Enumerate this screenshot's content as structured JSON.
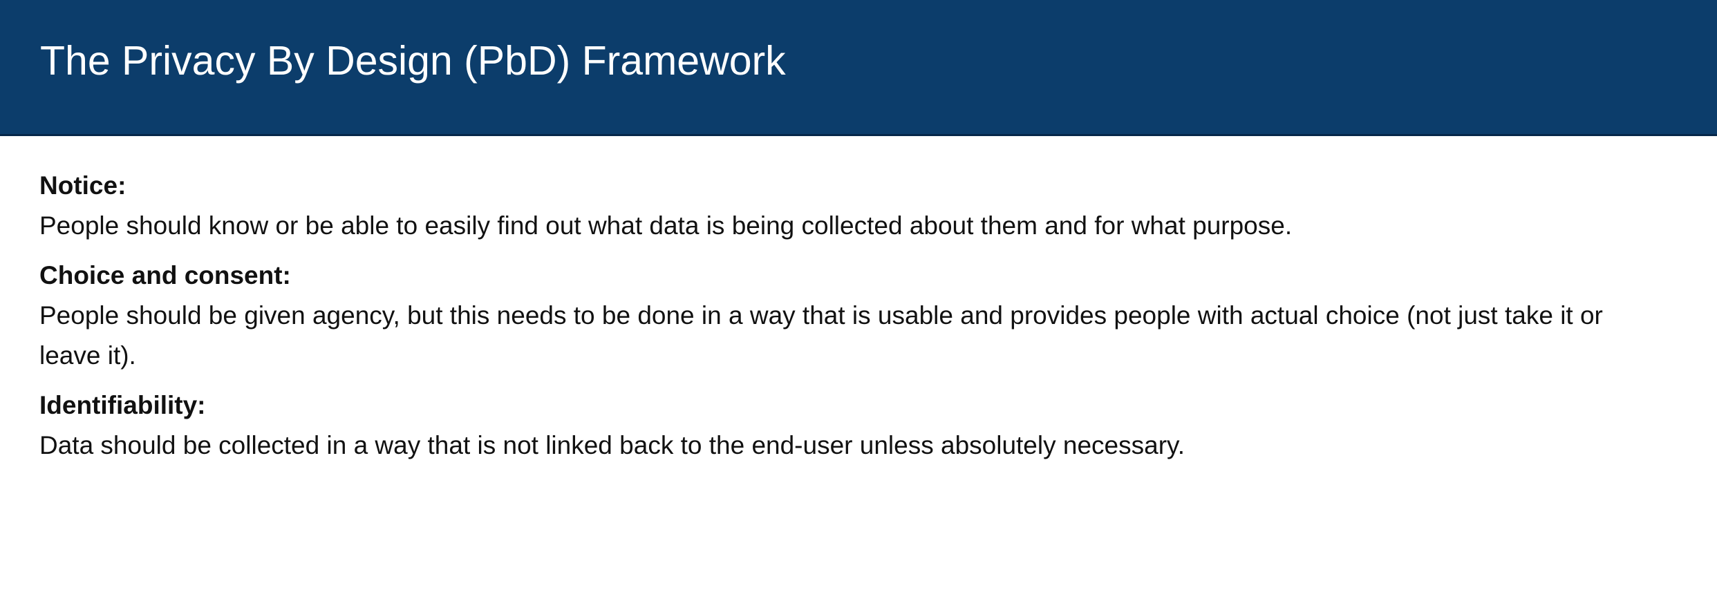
{
  "slide": {
    "title": "The Privacy By Design (PbD) Framework"
  },
  "sections": [
    {
      "heading": "Notice:",
      "text": "People should know or be able to easily find out what data is being collected about them and for what purpose."
    },
    {
      "heading": "Choice and consent:",
      "text": "People should be given agency, but this needs to be done in a way that is usable and provides people with actual choice (not just take it or leave it)."
    },
    {
      "heading": "Identifiability:",
      "text": "Data should be collected in a way that is not linked back to the end-user unless absolutely necessary."
    }
  ],
  "colors": {
    "header_background": "#0c3d6b",
    "title_text": "#ffffff",
    "body_text": "#111111"
  }
}
